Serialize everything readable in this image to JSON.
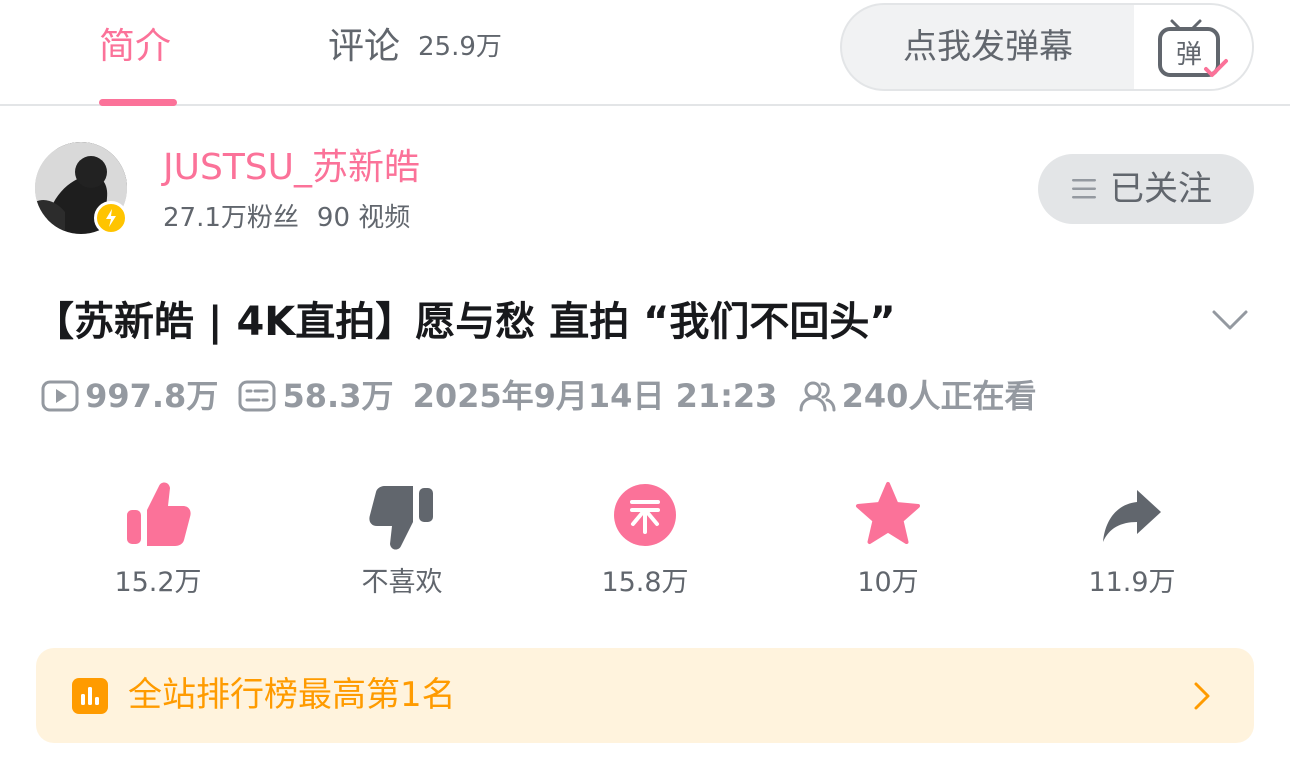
{
  "tabs": {
    "intro_label": "简介",
    "comments_label": "评论",
    "comments_count": "25.9万"
  },
  "danmaku": {
    "placeholder": "点我发弹幕",
    "toggle_glyph": "弹"
  },
  "uploader": {
    "name": "JUSTSU_苏新皓",
    "fans": "27.1万粉丝",
    "videos": "90 视频",
    "follow_label": "已关注"
  },
  "video": {
    "title": "【苏新皓 | 4K直拍】愿与愁 直拍 “我们不回头”",
    "views": "997.8万",
    "danmaku_count": "58.3万",
    "published": "2025年9月14日 21:23",
    "watching": "240人正在看"
  },
  "actions": [
    {
      "id": "like",
      "icon": "thumbs-up-icon",
      "label": "15.2万"
    },
    {
      "id": "dislike",
      "icon": "thumbs-down-icon",
      "label": "不喜欢"
    },
    {
      "id": "coin",
      "icon": "coin-icon",
      "label": "15.8万"
    },
    {
      "id": "favorite",
      "icon": "star-icon",
      "label": "10万"
    },
    {
      "id": "share",
      "icon": "share-icon",
      "label": "11.9万"
    }
  ],
  "ranking": {
    "text": "全站排行榜最高第1名"
  },
  "colors": {
    "brand_pink": "#fb7299",
    "gray_text": "#61666d",
    "meta_gray": "#9499a0",
    "rank_orange": "#ff9b00",
    "rank_bg": "#fff3dd"
  }
}
